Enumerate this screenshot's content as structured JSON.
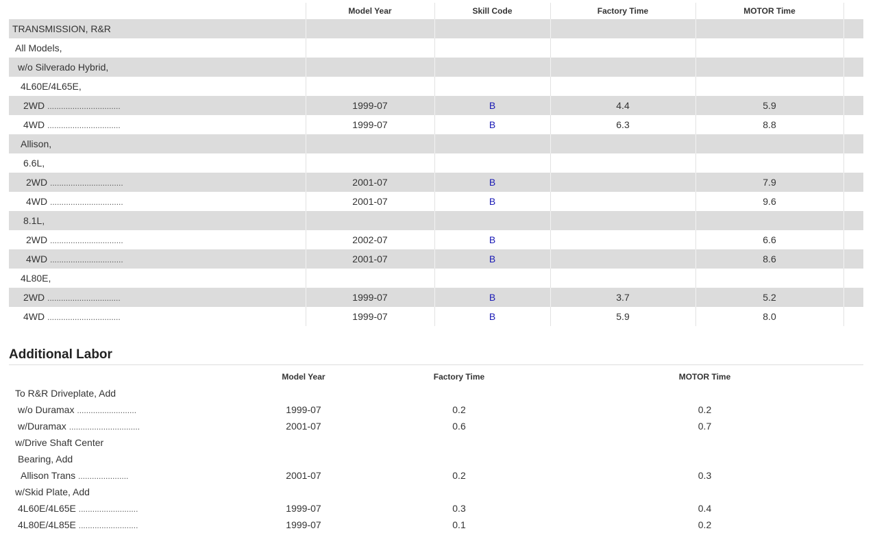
{
  "main_table": {
    "headers": [
      "",
      "Model Year",
      "Skill Code",
      "Factory Time",
      "MOTOR Time",
      ""
    ],
    "rows": [
      {
        "label": "TRANSMISSION, R&R",
        "indent": 5,
        "dots": "",
        "year": "",
        "skill": "",
        "factory": "",
        "motor": ""
      },
      {
        "label": "All Models,",
        "indent": 9,
        "dots": "",
        "year": "",
        "skill": "",
        "factory": "",
        "motor": ""
      },
      {
        "label": "w/o Silverado Hybrid,",
        "indent": 13,
        "dots": "",
        "year": "",
        "skill": "",
        "factory": "",
        "motor": ""
      },
      {
        "label": "4L60E/4L65E,",
        "indent": 17,
        "dots": "",
        "year": "",
        "skill": "",
        "factory": "",
        "motor": ""
      },
      {
        "label": "2WD",
        "indent": 21,
        "dots": "................................",
        "year": "1999-07",
        "skill": "B",
        "factory": "4.4",
        "motor": "5.9"
      },
      {
        "label": "4WD",
        "indent": 21,
        "dots": "................................",
        "year": "1999-07",
        "skill": "B",
        "factory": "6.3",
        "motor": "8.8"
      },
      {
        "label": "Allison,",
        "indent": 17,
        "dots": "",
        "year": "",
        "skill": "",
        "factory": "",
        "motor": ""
      },
      {
        "label": "6.6L,",
        "indent": 21,
        "dots": "",
        "year": "",
        "skill": "",
        "factory": "",
        "motor": ""
      },
      {
        "label": "2WD",
        "indent": 25,
        "dots": "................................",
        "year": "2001-07",
        "skill": "B",
        "factory": "",
        "motor": "7.9"
      },
      {
        "label": "4WD",
        "indent": 25,
        "dots": "................................",
        "year": "2001-07",
        "skill": "B",
        "factory": "",
        "motor": "9.6"
      },
      {
        "label": "8.1L,",
        "indent": 21,
        "dots": "",
        "year": "",
        "skill": "",
        "factory": "",
        "motor": ""
      },
      {
        "label": "2WD",
        "indent": 25,
        "dots": "................................",
        "year": "2002-07",
        "skill": "B",
        "factory": "",
        "motor": "6.6"
      },
      {
        "label": "4WD",
        "indent": 25,
        "dots": "................................",
        "year": "2001-07",
        "skill": "B",
        "factory": "",
        "motor": "8.6"
      },
      {
        "label": "4L80E,",
        "indent": 17,
        "dots": "",
        "year": "",
        "skill": "",
        "factory": "",
        "motor": ""
      },
      {
        "label": "2WD",
        "indent": 21,
        "dots": "................................",
        "year": "1999-07",
        "skill": "B",
        "factory": "3.7",
        "motor": "5.2"
      },
      {
        "label": "4WD",
        "indent": 21,
        "dots": "................................",
        "year": "1999-07",
        "skill": "B",
        "factory": "5.9",
        "motor": "8.0"
      }
    ]
  },
  "additional": {
    "title": "Additional Labor",
    "headers": [
      "",
      "Model Year",
      "Factory Time",
      "MOTOR Time"
    ],
    "rows": [
      {
        "label": "To R&R Driveplate, Add",
        "indent": 9,
        "dots": "",
        "year": "",
        "factory": "",
        "motor": ""
      },
      {
        "label": "w/o Duramax",
        "indent": 13,
        "dots": "..........................",
        "year": "1999-07",
        "factory": "0.2",
        "motor": "0.2"
      },
      {
        "label": "w/Duramax",
        "indent": 13,
        "dots": "...............................",
        "year": "2001-07",
        "factory": "0.6",
        "motor": "0.7"
      },
      {
        "label": "w/Drive Shaft Center",
        "indent": 9,
        "dots": "",
        "year": "",
        "factory": "",
        "motor": ""
      },
      {
        "label": "Bearing, Add",
        "indent": 13,
        "dots": "",
        "year": "",
        "factory": "",
        "motor": ""
      },
      {
        "label": "Allison Trans",
        "indent": 17,
        "dots": "......................",
        "year": "2001-07",
        "factory": "0.2",
        "motor": "0.3"
      },
      {
        "label": "w/Skid Plate, Add",
        "indent": 9,
        "dots": "",
        "year": "",
        "factory": "",
        "motor": ""
      },
      {
        "label": "4L60E/4L65E",
        "indent": 13,
        "dots": "..........................",
        "year": "1999-07",
        "factory": "0.3",
        "motor": "0.4"
      },
      {
        "label": "4L80E/4L85E",
        "indent": 13,
        "dots": "..........................",
        "year": "1999-07",
        "factory": "0.1",
        "motor": "0.2"
      }
    ]
  },
  "colors": {
    "skill_code": "#1a1ab5",
    "stripe": "#dcdcdc"
  }
}
